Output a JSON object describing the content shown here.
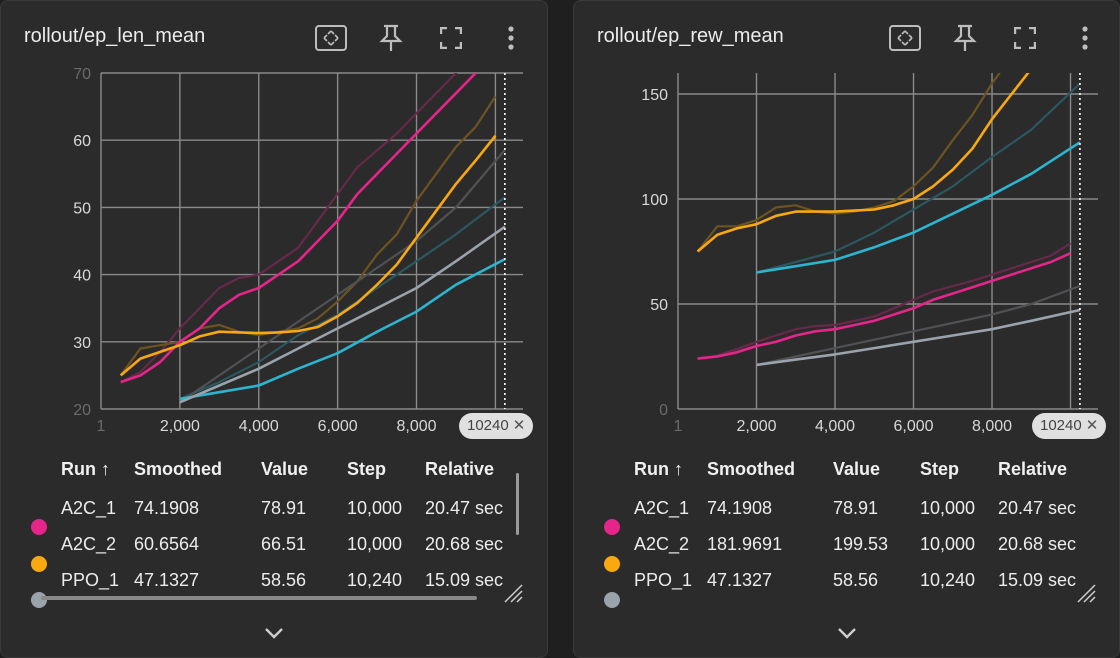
{
  "panels": [
    {
      "title": "rollout/ep_len_mean",
      "step_badge": "10240",
      "table": {
        "headers": [
          "Run ↑",
          "Smoothed",
          "Value",
          "Step",
          "Relative"
        ],
        "rows": [
          {
            "run": "A2C_1",
            "smoothed": "74.1908",
            "value": "78.91",
            "step": "10,000",
            "relative": "20.47 sec",
            "color": "#e5258a"
          },
          {
            "run": "A2C_2",
            "smoothed": "60.6564",
            "value": "66.51",
            "step": "10,000",
            "relative": "20.68 sec",
            "color": "#f9a80f"
          },
          {
            "run": "PPO_1",
            "smoothed": "47.1327",
            "value": "58.56",
            "step": "10,240",
            "relative": "15.09 sec",
            "color": "#9aa2ab"
          }
        ]
      }
    },
    {
      "title": "rollout/ep_rew_mean",
      "step_badge": "10240",
      "table": {
        "headers": [
          "Run ↑",
          "Smoothed",
          "Value",
          "Step",
          "Relative"
        ],
        "rows": [
          {
            "run": "A2C_1",
            "smoothed": "74.1908",
            "value": "78.91",
            "step": "10,000",
            "relative": "20.47 sec",
            "color": "#e5258a"
          },
          {
            "run": "A2C_2",
            "smoothed": "181.9691",
            "value": "199.53",
            "step": "10,000",
            "relative": "20.68 sec",
            "color": "#f9a80f"
          },
          {
            "run": "PPO_1",
            "smoothed": "47.1327",
            "value": "58.56",
            "step": "10,240",
            "relative": "15.09 sec",
            "color": "#9aa2ab"
          }
        ]
      }
    }
  ],
  "icons": {
    "fit": "fit-domain-icon",
    "pin": "pin-icon",
    "fullscreen": "fullscreen-icon",
    "menu": "more-vert-icon",
    "expand": "chevron-down-icon"
  },
  "chart_data": [
    {
      "type": "line",
      "title": "rollout/ep_len_mean",
      "xlabel": "",
      "ylabel": "",
      "xlim": [
        0,
        10700
      ],
      "ylim": [
        20,
        70
      ],
      "x_ticks": [
        "1",
        "2,000",
        "4,000",
        "6,000",
        "8,000"
      ],
      "y_ticks": [
        "20",
        "30",
        "40",
        "50",
        "60",
        "70"
      ],
      "grid": true,
      "cursor_step": 10240,
      "series": [
        {
          "color": "#e5258a",
          "x": [
            500,
            1000,
            1500,
            2000,
            2500,
            3000,
            3500,
            4000,
            4500,
            5000,
            5500,
            6000,
            6500,
            7000,
            7500,
            8000,
            8500,
            9000,
            9500,
            10000
          ],
          "smoothed": [
            24,
            25,
            27,
            30,
            32,
            35,
            37,
            38,
            40,
            42,
            45,
            48,
            52,
            55,
            58,
            61,
            64,
            67,
            70,
            74.19
          ],
          "raw": [
            24,
            25.5,
            28.5,
            32,
            35,
            38,
            39.5,
            40,
            42,
            44,
            48,
            52,
            56,
            58.5,
            61,
            64,
            67,
            70,
            73,
            78.91
          ]
        },
        {
          "color": "#f9a80f",
          "x": [
            500,
            1000,
            1500,
            2000,
            2500,
            3000,
            3500,
            4000,
            4500,
            5000,
            5500,
            6000,
            6500,
            7000,
            7500,
            8000,
            8500,
            9000,
            9500,
            10000
          ],
          "smoothed": [
            25,
            27.5,
            28.5,
            29.5,
            30.8,
            31.5,
            31.4,
            31.3,
            31.4,
            31.6,
            32.2,
            33.8,
            35.8,
            38.5,
            41.5,
            45.5,
            49.5,
            53.5,
            57,
            60.66
          ],
          "raw": [
            25,
            29,
            29.5,
            30,
            32,
            32.5,
            31.5,
            31,
            31.5,
            32,
            33.5,
            36,
            39,
            43,
            46,
            51,
            55,
            59,
            62,
            66.51
          ]
        },
        {
          "color": "#2bb5d1",
          "x": [
            2000,
            3000,
            4000,
            5000,
            6000,
            7000,
            8000,
            9000,
            10240
          ],
          "smoothed": [
            21.5,
            22.5,
            23.5,
            26,
            28.3,
            31.5,
            34.5,
            38.5,
            42.3
          ],
          "raw": [
            21.5,
            24,
            27,
            31,
            34,
            38,
            42,
            46,
            51.5
          ]
        },
        {
          "color": "#9aa2ab",
          "x": [
            2000,
            3000,
            4000,
            5000,
            6000,
            7000,
            8000,
            9000,
            10240
          ],
          "smoothed": [
            21,
            23.5,
            26,
            29,
            32,
            35,
            38,
            42,
            47.13
          ],
          "raw": [
            21,
            25,
            29,
            33,
            37,
            41,
            45,
            50,
            58.56
          ]
        }
      ]
    },
    {
      "type": "line",
      "title": "rollout/ep_rew_mean",
      "xlabel": "",
      "ylabel": "",
      "xlim": [
        0,
        10700
      ],
      "ylim": [
        0,
        160
      ],
      "x_ticks": [
        "1",
        "2,000",
        "4,000",
        "6,000",
        "8,000"
      ],
      "y_ticks": [
        "0",
        "50",
        "100",
        "150"
      ],
      "grid": true,
      "cursor_step": 10240,
      "series": [
        {
          "color": "#e5258a",
          "x": [
            500,
            1000,
            1500,
            2000,
            2500,
            3000,
            3500,
            4000,
            4500,
            5000,
            5500,
            6000,
            6500,
            7000,
            7500,
            8000,
            8500,
            9000,
            9500,
            10000
          ],
          "smoothed": [
            24,
            25,
            27,
            30,
            32,
            35,
            37,
            38,
            40,
            42,
            45,
            48,
            52,
            55,
            58,
            61,
            64,
            67,
            70,
            74.19
          ],
          "raw": [
            24,
            25.5,
            28.5,
            32,
            35,
            38,
            39.5,
            40,
            42,
            44,
            48,
            52,
            56,
            58.5,
            61,
            64,
            67,
            70,
            73,
            78.91
          ]
        },
        {
          "color": "#f9a80f",
          "x": [
            500,
            1000,
            1500,
            2000,
            2500,
            3000,
            3500,
            4000,
            4500,
            5000,
            5500,
            6000,
            6500,
            7000,
            7500,
            8000,
            8500,
            9000,
            9500,
            10000
          ],
          "smoothed": [
            75,
            83,
            86,
            88,
            92,
            94,
            94,
            94,
            94.5,
            95,
            97,
            100,
            106,
            114,
            124,
            138,
            150,
            162,
            172,
            181.97
          ],
          "raw": [
            75,
            87,
            87,
            90,
            96,
            97,
            94,
            93,
            94,
            96,
            99,
            106,
            115,
            128,
            140,
            155,
            168,
            180,
            190,
            199.53
          ]
        },
        {
          "color": "#2bb5d1",
          "x": [
            2000,
            3000,
            4000,
            5000,
            6000,
            7000,
            8000,
            9000,
            10240
          ],
          "smoothed": [
            65,
            68,
            71,
            77,
            84,
            93,
            102,
            112,
            127
          ],
          "raw": [
            65,
            70,
            75,
            84,
            95,
            106,
            120,
            133,
            155
          ]
        },
        {
          "color": "#9aa2ab",
          "x": [
            2000,
            3000,
            4000,
            5000,
            6000,
            7000,
            8000,
            9000,
            10240
          ],
          "smoothed": [
            21,
            23.5,
            26,
            29,
            32,
            35,
            38,
            42,
            47.13
          ],
          "raw": [
            21,
            25,
            29,
            33,
            37,
            41,
            45,
            50,
            58.56
          ]
        }
      ]
    }
  ]
}
